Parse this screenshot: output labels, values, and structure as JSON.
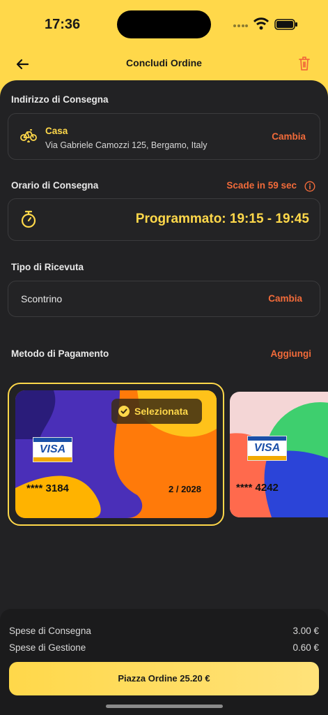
{
  "status_bar": {
    "time": "17:36"
  },
  "header": {
    "title": "Concludi Ordine"
  },
  "delivery_address": {
    "section_title": "Indirizzo di Consegna",
    "name": "Casa",
    "address": "Via Gabriele Camozzi 125, Bergamo, Italy",
    "change_label": "Cambia"
  },
  "delivery_time": {
    "section_title": "Orario di Consegna",
    "expiry": "Scade in 59 sec",
    "scheduled": "Programmato: 19:15 - 19:45"
  },
  "receipt": {
    "section_title": "Tipo di Ricevuta",
    "value": "Scontrino",
    "change_label": "Cambia"
  },
  "payment": {
    "section_title": "Metodo di Pagamento",
    "add_label": "Aggiungi",
    "cards": [
      {
        "brand": "VISA",
        "number": "**** 3184",
        "expiry": "2 / 2028",
        "selected_label": "Selezionata"
      },
      {
        "brand": "VISA",
        "number": "**** 4242"
      }
    ]
  },
  "summary": {
    "rows": [
      {
        "label": "Spese di Consegna",
        "value": "3.00 €"
      },
      {
        "label": "Spese di Gestione",
        "value": "0.60 €"
      }
    ],
    "place_order_label": "Piazza Ordine 25.20 €"
  },
  "colors": {
    "accent_yellow": "#FFD84A",
    "accent_orange": "#F26B3A",
    "panel_dark": "#222224"
  }
}
